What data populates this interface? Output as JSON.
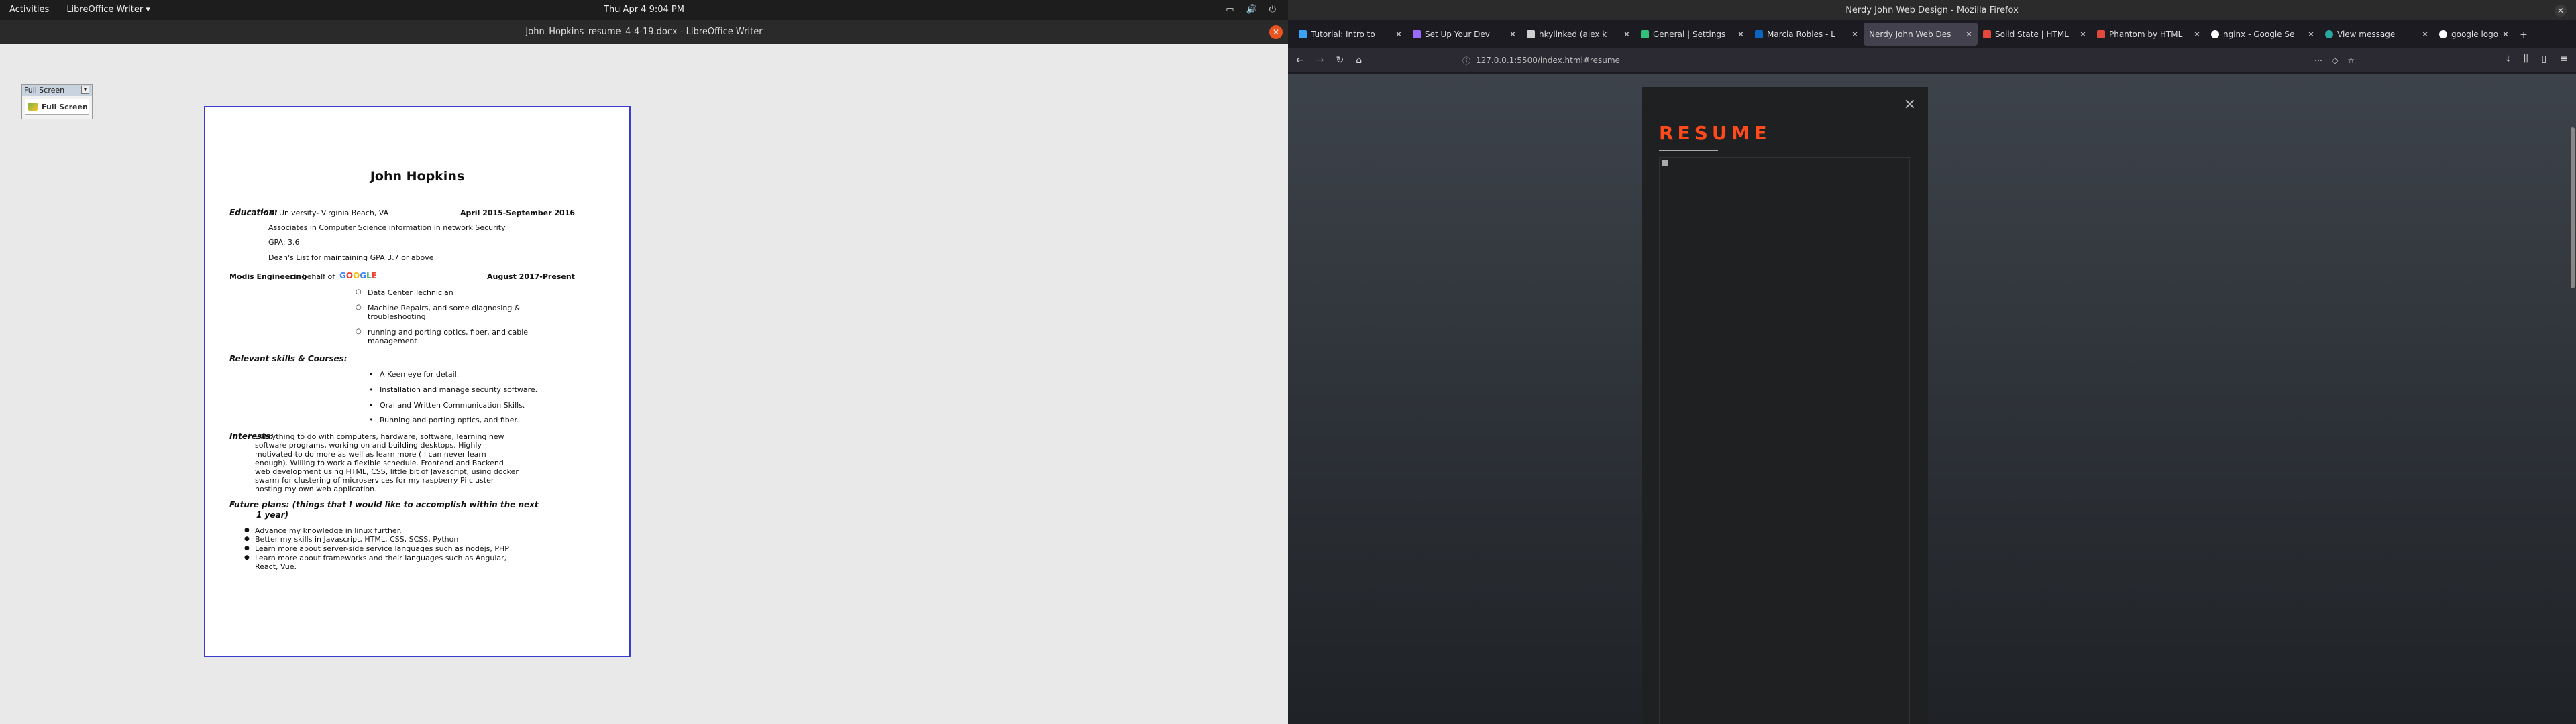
{
  "system": {
    "activities": "Activities",
    "app_menu": "LibreOffice Writer",
    "clock": "Thu Apr 4   9:04 PM"
  },
  "firefox_window": {
    "title": "Nerdy John Web Design - Mozilla Firefox",
    "url": "127.0.0.1:5500/index.html#resume"
  },
  "writer_window": {
    "title": "John_Hopkins_resume_4-4-19.docx - LibreOffice Writer",
    "fullscreen_toolbar_title": "Full Screen",
    "fullscreen_button": "Full Screen"
  },
  "resume": {
    "name": "John Hopkins",
    "education_label": "Education:",
    "education_school": "ECPI University- Virginia Beach, VA",
    "education_dates": "April 2015-September 2016",
    "education_degree": "Associates in Computer Science information in network Security",
    "education_gpa": "GPA: 3.6",
    "education_honor": "Dean's List for maintaining GPA 3.7 or above",
    "work_company": "Modis Engineering",
    "work_behalf": "- on behalf of",
    "work_google_letters": [
      "G",
      "O",
      "O",
      "G",
      "L",
      "E"
    ],
    "work_dates": "August 2017-Present",
    "work_items": [
      "Data Center Technician",
      "Machine Repairs, and some diagnosing &",
      "troubleshooting",
      "running and porting optics, fiber, and cable",
      "management"
    ],
    "skills_label": "Relevant skills & Courses:",
    "skills": [
      "A Keen eye for detail.",
      "Installation and manage security software.",
      "Oral and Written Communication Skills.",
      "Running and porting optics, and fiber."
    ],
    "interests_label": "Interests:",
    "interests_lines": [
      "Everything to do with computers, hardware, software, learning new",
      "software programs, working on and building desktops. Highly",
      "motivated to do more as well as learn more ( I can never learn",
      "enough). Willing to work a flexible schedule.  Frontend and Backend",
      "web development using HTML, CSS, little bit of Javascript, using docker",
      "swarm for clustering of microservices for my raspberry Pi cluster",
      "hosting my own web application."
    ],
    "future_label": "Future plans: (things that I would like to accomplish within the next",
    "future_label2": "1 year)",
    "future_items": [
      "Advance my knowledge in linux further.",
      "Better my skills in Javascript, HTML, CSS, SCSS, Python",
      "Learn more about server-side  service languages  such as nodejs, PHP",
      "Learn more about frameworks and their languages such as Angular,",
      "React, Vue."
    ]
  },
  "tabs": [
    {
      "label": "Tutorial: Intro to",
      "color": "#3aa3f5"
    },
    {
      "label": "Set Up Your Dev",
      "color": "#9b6bff"
    },
    {
      "label": "hkylinked (alex k",
      "color": "#cfcfcf"
    },
    {
      "label": "General | Settings",
      "color": "#2fc27a"
    },
    {
      "label": "Marcia Robles - L",
      "color": "#0a66c2"
    },
    {
      "label": "Nerdy John Web Des",
      "color": "#eeeeee"
    },
    {
      "label": "Solid State | HTML",
      "color": "#e2483b"
    },
    {
      "label": "Phantom by HTML",
      "color": "#e2483b"
    },
    {
      "label": "nginx - Google Se",
      "color": "#ffffff"
    },
    {
      "label": "View message",
      "color": "#2aa7a0"
    },
    {
      "label": "google logo colo",
      "color": "#ffffff"
    }
  ],
  "modal": {
    "heading": "RESUME"
  },
  "colors": {
    "accent": "#ff4a1c",
    "page_border": "#3b3bd1"
  }
}
